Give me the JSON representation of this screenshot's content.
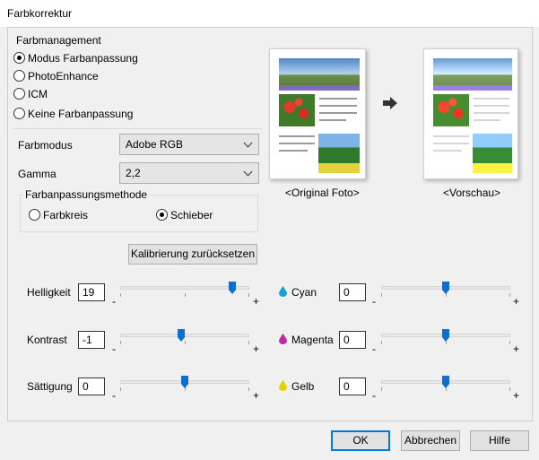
{
  "window": {
    "title": "Farbkorrektur"
  },
  "color_management": {
    "group_label": "Farbmanagement",
    "options": [
      {
        "label": "Modus Farbanpassung",
        "checked": true
      },
      {
        "label": "PhotoEnhance",
        "checked": false
      },
      {
        "label": "ICM",
        "checked": false
      },
      {
        "label": "Keine Farbanpassung",
        "checked": false
      }
    ]
  },
  "color_mode": {
    "label": "Farbmodus",
    "value": "Adobe RGB"
  },
  "gamma": {
    "label": "Gamma",
    "value": "2,2"
  },
  "method": {
    "group_label": "Farbanpassungsmethode",
    "options": [
      {
        "label": "Farbkreis",
        "checked": false
      },
      {
        "label": "Schieber",
        "checked": true
      }
    ]
  },
  "reset_button": "Kalibrierung zurücksetzen",
  "preview": {
    "original_label": "<Original Foto>",
    "preview_label": "<Vorschau>"
  },
  "sliders_left": [
    {
      "label": "Helligkeit",
      "value": "19",
      "position": 0.87
    },
    {
      "label": "Kontrast",
      "value": "-1",
      "position": 0.47
    },
    {
      "label": "Sättigung",
      "value": "0",
      "position": 0.5
    }
  ],
  "sliders_right": [
    {
      "label": "Cyan",
      "value": "0",
      "position": 0.5,
      "color": "#1a9fd9"
    },
    {
      "label": "Magenta",
      "value": "0",
      "position": 0.5,
      "color": "#c12aa5"
    },
    {
      "label": "Gelb",
      "value": "0",
      "position": 0.5,
      "color": "#e2d200"
    }
  ],
  "minus": "-",
  "plus": "+",
  "buttons": {
    "ok": "OK",
    "cancel": "Abbrechen",
    "help": "Hilfe"
  }
}
